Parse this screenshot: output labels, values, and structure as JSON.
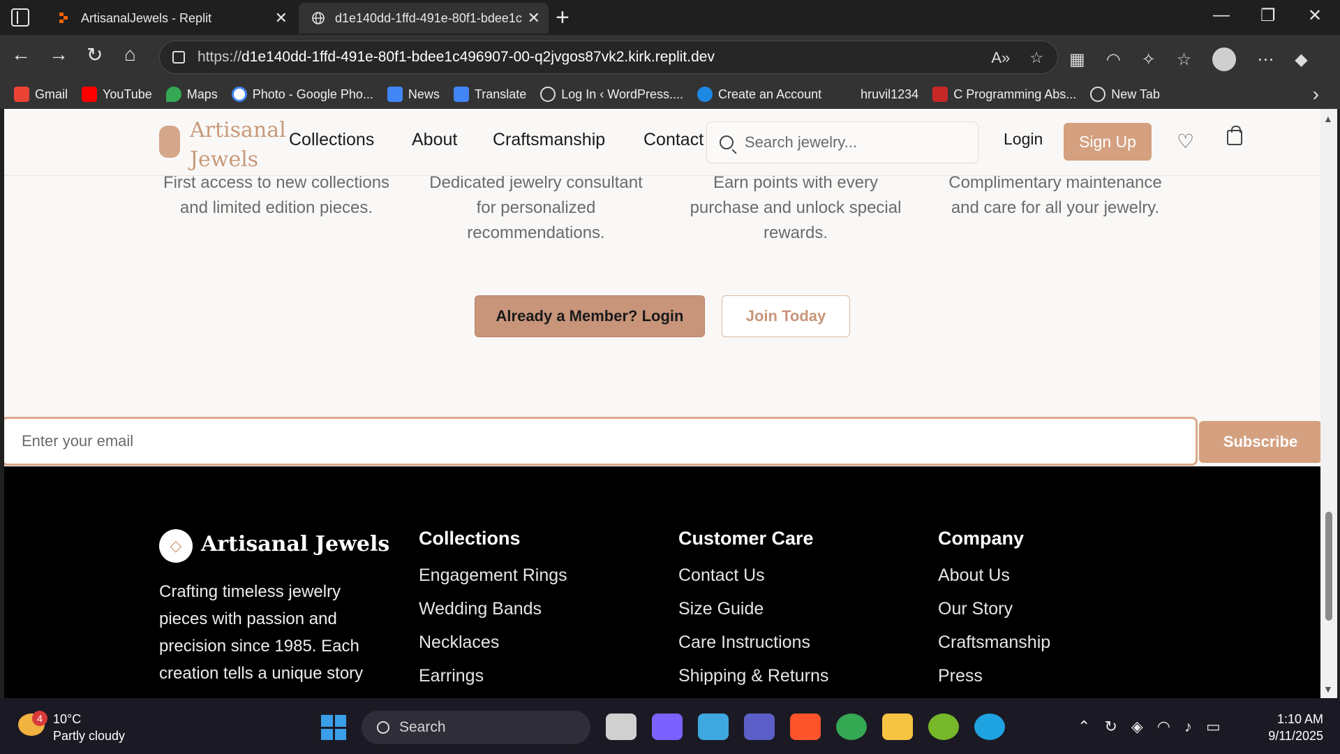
{
  "browser": {
    "tabs": [
      {
        "title": "ArtisanalJewels - Replit",
        "active": false
      },
      {
        "title": "d1e140dd-1ffd-491e-80f1-bdee1c",
        "active": true
      }
    ],
    "url_prefix": "https://",
    "url_host": "d1e140dd-1ffd-491e-80f1-bdee1c496907-00-q2jvgos87vk2.kirk.replit.dev",
    "bookmarks": [
      {
        "label": "Gmail",
        "color": "#ea4335"
      },
      {
        "label": "YouTube",
        "color": "#ff0000"
      },
      {
        "label": "Maps",
        "color": "#34a853"
      },
      {
        "label": "Photo - Google Pho...",
        "color": "#4285f4"
      },
      {
        "label": "News",
        "color": "#4285f4"
      },
      {
        "label": "Translate",
        "color": "#4285f4"
      },
      {
        "label": "Log In ‹ WordPress....",
        "color": "#9e9e9e"
      },
      {
        "label": "Create an Account",
        "color": "#1e88e5"
      },
      {
        "label": "hruvil1234",
        "color": "transparent"
      },
      {
        "label": "C Programming Abs...",
        "color": "#c62828"
      },
      {
        "label": "New Tab",
        "color": "#9e9e9e"
      }
    ]
  },
  "header": {
    "brand": "Artisanal Jewels",
    "nav": [
      "Collections",
      "About",
      "Craftsmanship",
      "Contact"
    ],
    "search_placeholder": "Search jewelry...",
    "login": "Login",
    "signup": "Sign Up"
  },
  "benefits": [
    "First access to new collections and limited edition pieces.",
    "Dedicated jewelry consultant for personalized recommendations.",
    "Earn points with every purchase and unlock special rewards.",
    "Complimentary maintenance and care for all your jewelry."
  ],
  "cta": {
    "member_login": "Already a Member? Login",
    "join": "Join Today"
  },
  "newsletter": {
    "email_placeholder": "Enter your email",
    "subscribe": "Subscribe"
  },
  "footer": {
    "brand": "Artisanal Jewels",
    "description": "Crafting timeless jewelry pieces with passion and precision since 1985. Each creation tells a unique story",
    "columns": [
      {
        "heading": "Collections",
        "links": [
          "Engagement Rings",
          "Wedding Bands",
          "Necklaces",
          "Earrings"
        ]
      },
      {
        "heading": "Customer Care",
        "links": [
          "Contact Us",
          "Size Guide",
          "Care Instructions",
          "Shipping & Returns"
        ]
      },
      {
        "heading": "Company",
        "links": [
          "About Us",
          "Our Story",
          "Craftsmanship",
          "Press"
        ]
      }
    ]
  },
  "taskbar": {
    "weather_temp": "10°C",
    "weather_desc": "Partly cloudy",
    "weather_badge": "4",
    "search": "Search",
    "time": "1:10 AM",
    "date": "9/11/2025"
  },
  "colors": {
    "accent": "#d4a080",
    "accent_dark": "#c8957a",
    "footer_bg": "#000000",
    "page_bg": "#faf8f6"
  }
}
